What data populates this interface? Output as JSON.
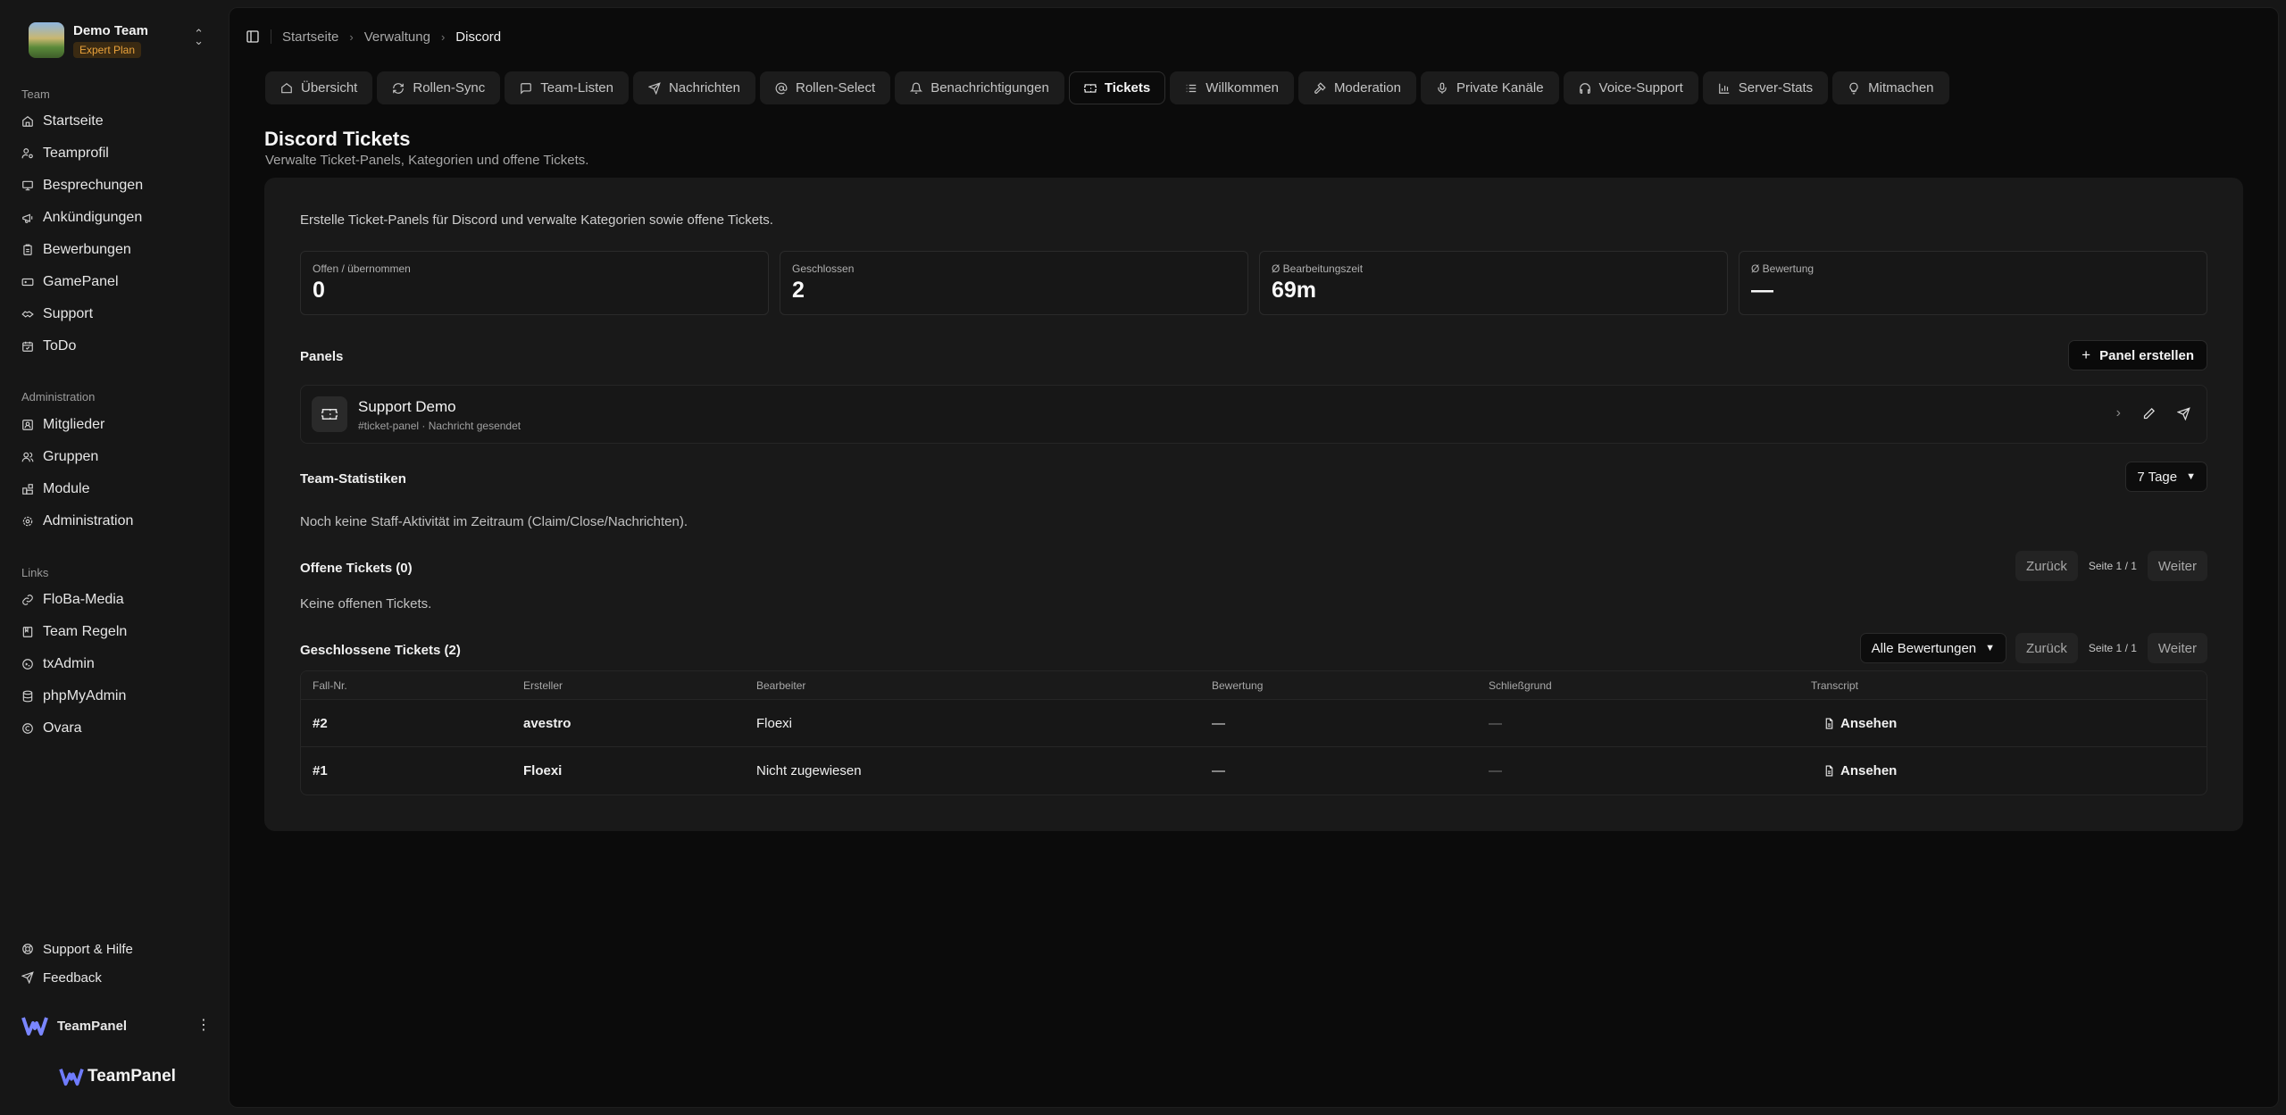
{
  "team": {
    "name": "Demo Team",
    "plan": "Expert Plan"
  },
  "nav": {
    "team_label": "Team",
    "team_items": [
      {
        "label": "Startseite",
        "icon": "home-icon"
      },
      {
        "label": "Teamprofil",
        "icon": "user-cog-icon"
      },
      {
        "label": "Besprechungen",
        "icon": "monitor-icon"
      },
      {
        "label": "Ankündigungen",
        "icon": "megaphone-icon"
      },
      {
        "label": "Bewerbungen",
        "icon": "clipboard-icon"
      },
      {
        "label": "GamePanel",
        "icon": "gamepad-icon"
      },
      {
        "label": "Support",
        "icon": "handshake-icon"
      },
      {
        "label": "ToDo",
        "icon": "calendar-check-icon"
      }
    ],
    "admin_label": "Administration",
    "admin_items": [
      {
        "label": "Mitglieder",
        "icon": "id-card-icon"
      },
      {
        "label": "Gruppen",
        "icon": "users-icon"
      },
      {
        "label": "Module",
        "icon": "blocks-icon"
      },
      {
        "label": "Administration",
        "icon": "settings-icon"
      }
    ],
    "links_label": "Links",
    "link_items": [
      {
        "label": "FloBa-Media",
        "icon": "link-icon"
      },
      {
        "label": "Team Regeln",
        "icon": "book-icon"
      },
      {
        "label": "txAdmin",
        "icon": "terminal-icon"
      },
      {
        "label": "phpMyAdmin",
        "icon": "database-icon"
      },
      {
        "label": "Ovara",
        "icon": "copyright-icon"
      }
    ],
    "footer_items": [
      {
        "label": "Support & Hilfe",
        "icon": "lifebuoy-icon"
      },
      {
        "label": "Feedback",
        "icon": "send-icon"
      }
    ]
  },
  "user": {
    "name": "TeamPanel"
  },
  "brand": {
    "name": "TeamPanel"
  },
  "breadcrumb": [
    "Startseite",
    "Verwaltung",
    "Discord"
  ],
  "tabs": [
    {
      "label": "Übersicht",
      "icon": "home-icon",
      "active": false
    },
    {
      "label": "Rollen-Sync",
      "icon": "refresh-icon",
      "active": false
    },
    {
      "label": "Team-Listen",
      "icon": "message-square-icon",
      "active": false
    },
    {
      "label": "Nachrichten",
      "icon": "send-icon",
      "active": false
    },
    {
      "label": "Rollen-Select",
      "icon": "at-sign-icon",
      "active": false
    },
    {
      "label": "Benachrichtigungen",
      "icon": "bell-icon",
      "active": false
    },
    {
      "label": "Tickets",
      "icon": "ticket-icon",
      "active": true
    },
    {
      "label": "Willkommen",
      "icon": "list-icon",
      "active": false
    },
    {
      "label": "Moderation",
      "icon": "hammer-icon",
      "active": false
    },
    {
      "label": "Private Kanäle",
      "icon": "mic-icon",
      "active": false
    },
    {
      "label": "Voice-Support",
      "icon": "headphones-icon",
      "active": false
    },
    {
      "label": "Server-Stats",
      "icon": "bar-chart-icon",
      "active": false
    },
    {
      "label": "Mitmachen",
      "icon": "lightbulb-icon",
      "active": false
    }
  ],
  "page": {
    "title": "Discord Tickets",
    "subtitle": "Verwalte Ticket-Panels, Kategorien und offene Tickets.",
    "intro": "Erstelle Ticket-Panels für Discord und verwalte Kategorien sowie offene Tickets."
  },
  "stats": [
    {
      "label": "Offen / übernommen",
      "value": "0"
    },
    {
      "label": "Geschlossen",
      "value": "2"
    },
    {
      "label": "Ø Bearbeitungszeit",
      "value": "69m"
    },
    {
      "label": "Ø Bewertung",
      "value": "—"
    }
  ],
  "panels": {
    "title": "Panels",
    "create_label": "Panel erstellen",
    "items": [
      {
        "name": "Support Demo",
        "meta": "#ticket-panel · Nachricht gesendet"
      }
    ]
  },
  "team_stats": {
    "title": "Team-Statistiken",
    "range": "7 Tage",
    "empty": "Noch keine Staff-Aktivität im Zeitraum (Claim/Close/Nachrichten)."
  },
  "open_tickets": {
    "title": "Offene Tickets (0)",
    "empty": "Keine offenen Tickets.",
    "prev": "Zurück",
    "page": "Seite 1 / 1",
    "next": "Weiter"
  },
  "closed_tickets": {
    "title": "Geschlossene Tickets (2)",
    "filter": "Alle Bewertungen",
    "prev": "Zurück",
    "page": "Seite 1 / 1",
    "next": "Weiter",
    "columns": [
      "Fall-Nr.",
      "Ersteller",
      "Bearbeiter",
      "Bewertung",
      "Schließgrund",
      "Transcript"
    ],
    "rows": [
      {
        "case": "#2",
        "creator": "avestro",
        "handler": "Floexi",
        "rating": "—",
        "reason": "—",
        "transcript": "Ansehen"
      },
      {
        "case": "#1",
        "creator": "Floexi",
        "handler": "Nicht zugewiesen",
        "rating": "—",
        "reason": "—",
        "transcript": "Ansehen"
      }
    ]
  }
}
